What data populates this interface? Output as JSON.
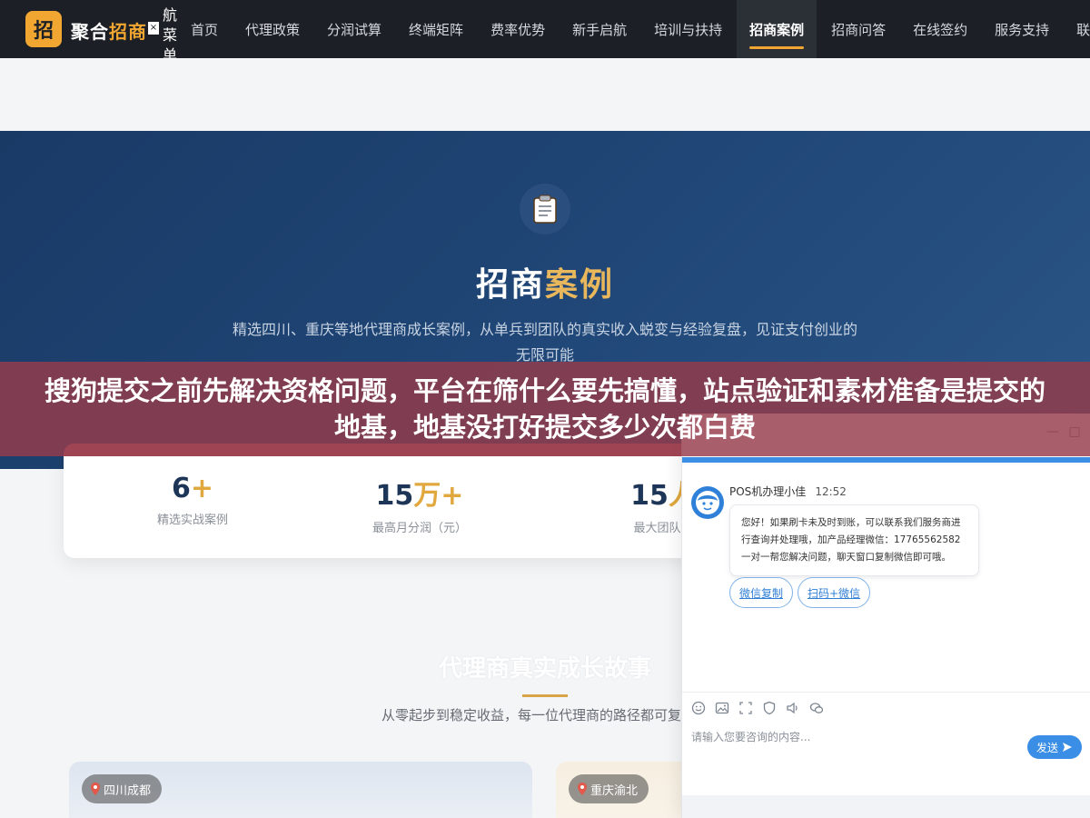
{
  "nav": {
    "logo_badge": "招",
    "logo_text_main": "聚合",
    "logo_text_accent": "招商",
    "close_glyph": "×",
    "menu_toggle": "航菜单",
    "items": [
      {
        "label": "首页"
      },
      {
        "label": "代理政策"
      },
      {
        "label": "分润试算"
      },
      {
        "label": "终端矩阵"
      },
      {
        "label": "费率优势"
      },
      {
        "label": "新手启航"
      },
      {
        "label": "培训与扶持"
      },
      {
        "label": "招商案例"
      },
      {
        "label": "招商问答"
      },
      {
        "label": "在线签约"
      },
      {
        "label": "服务支持"
      },
      {
        "label": "联系"
      }
    ],
    "active_index": 7
  },
  "hero": {
    "title_main": "招商",
    "title_accent": "案例",
    "description": "精选四川、重庆等地代理商成长案例，从单兵到团队的真实收入蜕变与经验复盘，见证支付创业的无限可能"
  },
  "banner": {
    "text": "搜狗提交之前先解决资格问题，平台在筛什么要先搞懂，站点验证和素材准备是提交的地基，地基没打好提交多少次都白费"
  },
  "stats": [
    {
      "value": "6",
      "unit": "",
      "suffix": "+",
      "label": "精选实战案例"
    },
    {
      "value": "15",
      "unit": "万",
      "suffix": "+",
      "label": "最高月分润（元）"
    },
    {
      "value": "15",
      "unit": "人",
      "suffix": "",
      "label": "最大团队规"
    }
  ],
  "stories": {
    "title": "代理商真实成长故事",
    "description": "从零起步到稳定收益，每一位代理商的路径都可复制。",
    "cards": [
      {
        "tag": "四川成都"
      },
      {
        "tag": "重庆渝北"
      }
    ]
  },
  "chat": {
    "minimize": "—",
    "maximize": "□",
    "sender": "POS机办理小佳",
    "time": "12:52",
    "message": "您好！如果刷卡未及时到账，可以联系我们服务商进行查询并处理哦，加产品经理微信：17765562582 一对一帮您解决问题，聊天窗口复制微信即可哦。",
    "actions": [
      "微信复制",
      "扫码+微信"
    ],
    "input_placeholder": "请输入您要咨询的内容...",
    "send_label": "发送"
  },
  "colors": {
    "nav_bg": "#1c2026",
    "accent": "#f0a630",
    "hero_bg": "#1f4676",
    "banner_bg": "#963c4b",
    "chat_blue": "#3a8ee6"
  }
}
